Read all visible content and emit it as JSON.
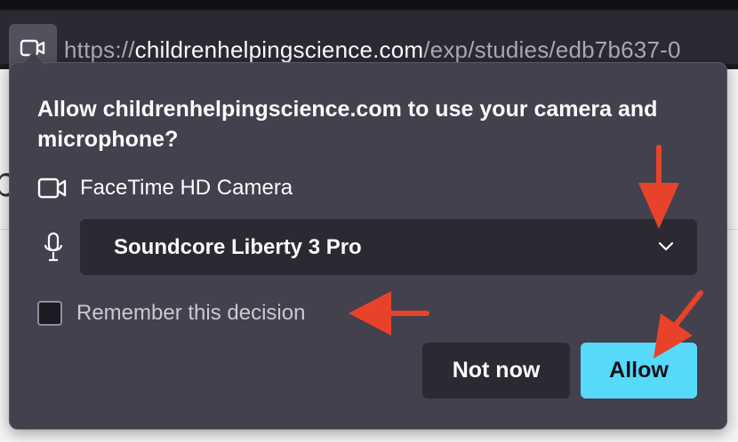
{
  "browser": {
    "url_scheme": "https://",
    "url_host": "childrenhelpingscience.com",
    "url_path": "/exp/studies/edb7b637-0"
  },
  "permission_panel": {
    "title": "Allow childrenhelpingscience.com to use your camera and microphone?",
    "camera_label": "FaceTime HD Camera",
    "microphone_selected": "Soundcore Liberty 3 Pro",
    "remember_label": "Remember this decision",
    "remember_checked": false,
    "not_now_label": "Not now",
    "allow_label": "Allow",
    "allow_color": "#57d9f9"
  },
  "annotations": {
    "arrow_color": "#e8432a",
    "arrow_targets": [
      "microphone-dropdown-chevron",
      "remember-checkbox",
      "allow-button"
    ]
  }
}
